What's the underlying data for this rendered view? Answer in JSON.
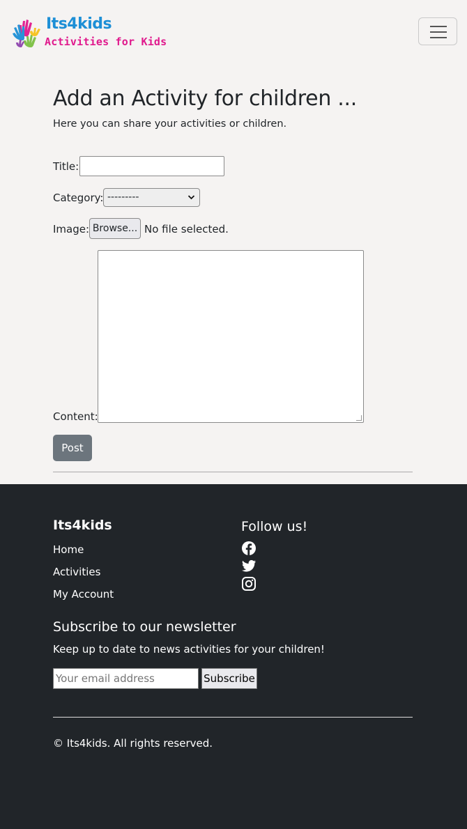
{
  "brand": {
    "logo_title": "Its4kids",
    "logo_subtitle": "Activities for Kids"
  },
  "nav": {
    "toggler_icon": "hamburger-menu-icon"
  },
  "page": {
    "title": "Add an Activity for children ...",
    "lead": "Here you can share your activities or children."
  },
  "form": {
    "title_label": "Title:",
    "title_value": "",
    "category_label": "Category:",
    "category_selected": "---------",
    "image_label": "Image:",
    "browse_label": "Browse...",
    "file_status": "No file selected.",
    "content_label": "Content:",
    "content_value": "",
    "post_label": "Post"
  },
  "footer": {
    "brand": "Its4kids",
    "links": [
      "Home",
      "Activities",
      "My Account"
    ],
    "follow_title": "Follow us!",
    "social_icons": [
      "facebook-icon",
      "twitter-icon",
      "instagram-icon"
    ],
    "newsletter_title": "Subscribe to our newsletter",
    "newsletter_text": "Keep up to date to news activities for your children!",
    "email_placeholder": "Your email address",
    "subscribe_label": "Subscribe",
    "copyright": "© Its4kids. All rights reserved."
  },
  "colors": {
    "page_bg": "#f5f3f2",
    "footer_bg": "#212529",
    "logo_blue": "#1d8fd6",
    "logo_pink": "#e0198d",
    "post_button": "#6c757d"
  }
}
